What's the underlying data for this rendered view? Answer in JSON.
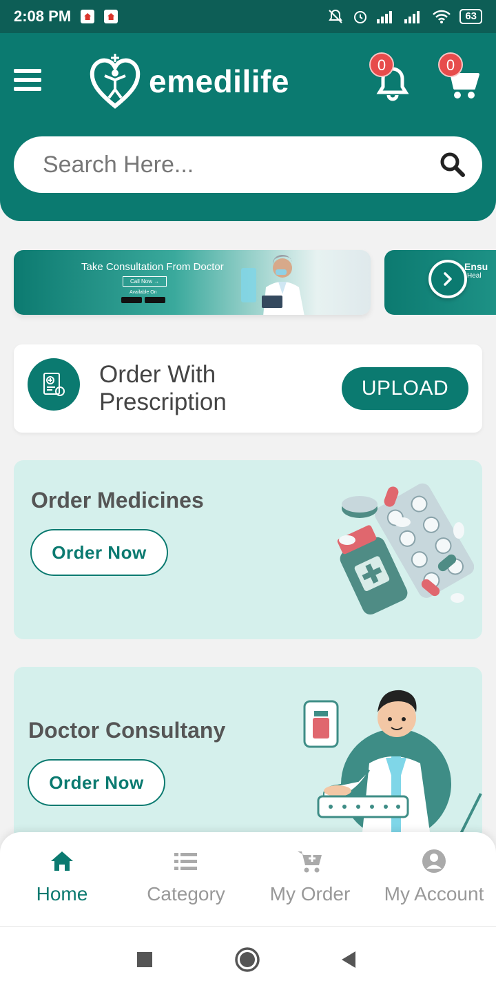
{
  "status_bar": {
    "time": "2:08 PM",
    "battery": "63"
  },
  "header": {
    "logo_text": "emedilife",
    "notifications_count": "0",
    "cart_count": "0"
  },
  "search": {
    "placeholder": "Search Here..."
  },
  "banners": [
    {
      "title": "Take Consultation From Doctor",
      "cta": "Call Now →",
      "available": "Available On"
    },
    {
      "title": "Ensu",
      "sub": "Heal"
    }
  ],
  "prescription": {
    "title": "Order With Prescription",
    "button": "UPLOAD"
  },
  "features": [
    {
      "title": "Order Medicines",
      "button": "Order Now"
    },
    {
      "title": "Doctor Consultany",
      "button": "Order Now"
    }
  ],
  "bottom_nav": [
    {
      "label": "Home",
      "icon": "home-icon",
      "active": true
    },
    {
      "label": "Category",
      "icon": "list-icon",
      "active": false
    },
    {
      "label": "My Order",
      "icon": "cart-plus-icon",
      "active": false
    },
    {
      "label": "My Account",
      "icon": "account-icon",
      "active": false
    }
  ],
  "colors": {
    "primary": "#0b7a70",
    "status_bar": "#0d5e56",
    "badge": "#e74c4c",
    "card_bg": "#d5f0ec"
  }
}
